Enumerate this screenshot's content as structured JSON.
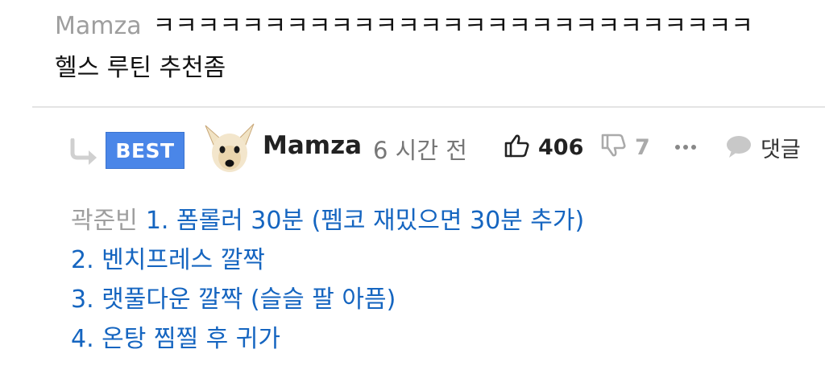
{
  "parent_comment": {
    "author": "Mamza",
    "line1": "ㅋㅋㅋㅋㅋㅋㅋㅋㅋㅋㅋㅋㅋㅋㅋㅋㅋㅋㅋㅋㅋㅋㅋㅋㅋㅋㅋ",
    "line2": "헬스 루틴 추천좀"
  },
  "reply": {
    "badge": "BEST",
    "author": "Mamza",
    "time": "6 시간 전",
    "likes": "406",
    "dislikes": "7",
    "reply_label": "댓글",
    "mention": "곽준빈",
    "lines": [
      "1. 폼롤러 30분 (펨코 재밌으면 30분 추가)",
      "2. 벤치프레스 깔짝",
      "3. 랫풀다운 깔짝 (슬슬 팔 아픔)",
      "4. 온탕 찜찔 후 귀가"
    ]
  },
  "colors": {
    "badge_bg": "#4a86e8",
    "link_text": "#1565c0",
    "muted": "#9e9e9e"
  },
  "icons": [
    "reply-arrow-icon",
    "thumbs-up-icon",
    "thumbs-down-icon",
    "more-dots-icon",
    "speech-bubble-icon"
  ]
}
